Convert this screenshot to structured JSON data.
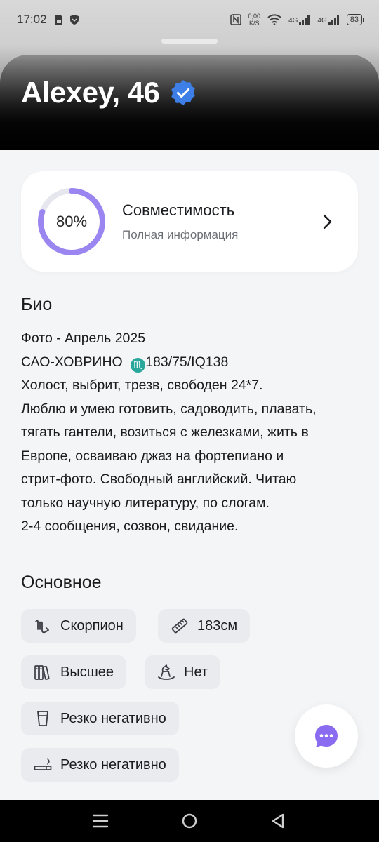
{
  "status_bar": {
    "time": "17:02",
    "net_speed": "0,00\nK/S",
    "battery": "83",
    "signal_1": "4G",
    "signal_2": "4G"
  },
  "profile": {
    "name_age": "Alexey, 46",
    "verified": true
  },
  "compatibility": {
    "percent_label": "80%",
    "percent_value": 80,
    "title": "Совместимость",
    "subtitle": "Полная информация",
    "ring_color": "#9b85f0",
    "ring_track_color": "#e6e6ee"
  },
  "bio": {
    "section_title": "Био",
    "line1": "Фото - Апрель 2025",
    "line2_a": "САО-ХОВРИНО ",
    "line2_b": "183/75/IQ138",
    "zodiac_glyph": "♏",
    "line3": "Холост, выбрит, трезв, свободен 24*7.",
    "line4": "Люблю и умею готовить, садоводить, плавать,",
    "line5": "тягать гантели, возиться с железками, жить в",
    "line6": "Европе, осваиваю джаз на фортепиано и",
    "line7": "стрит-фото. Свободный английский. Читаю",
    "line8": "только научную литературу, по слогам.",
    "line9": "2-4 сообщения, созвон, свидание."
  },
  "basics": {
    "section_title": "Основное",
    "chips": [
      {
        "label": "Скорпион",
        "icon": "scorpio-icon"
      },
      {
        "label": "183см",
        "icon": "ruler-icon"
      },
      {
        "label": "Высшее",
        "icon": "books-icon"
      },
      {
        "label": "Нет",
        "icon": "rocking-horse-icon"
      },
      {
        "label": "Резко негативно",
        "icon": "glass-icon"
      },
      {
        "label": "Резко негативно",
        "icon": "cigarette-icon"
      }
    ]
  },
  "colors": {
    "accent": "#8a6cf0",
    "chip_bg": "#e9ebef",
    "verified": "#3d7fe6"
  }
}
